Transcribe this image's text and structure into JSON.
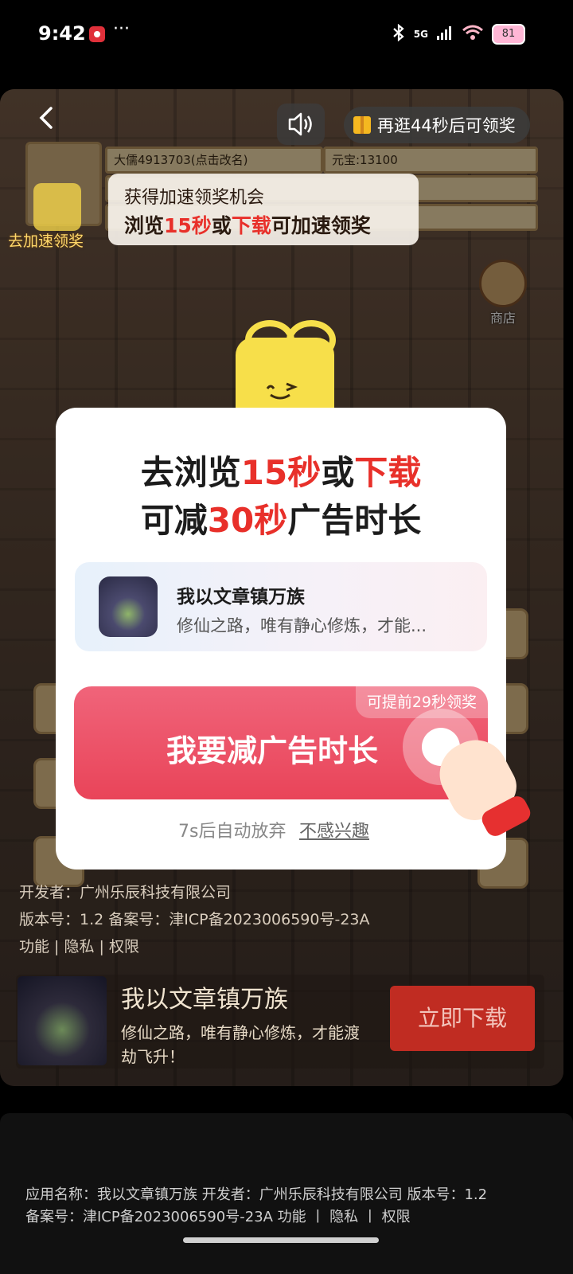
{
  "status_bar": {
    "time": "9:42",
    "dots": "···",
    "network": "5G",
    "battery": "81"
  },
  "game": {
    "player_name": "大儒4913703(点击改名)",
    "currency": "元宝:13100",
    "tip_line1": "获得加速领奖机会",
    "tip_line2_a": "浏览",
    "tip_line2_b": "15秒",
    "tip_line2_c": "或",
    "tip_line2_d": "下载",
    "tip_line2_e": "可加速领奖",
    "speed_label": "去加速领奖",
    "shop_label": "商店"
  },
  "reward_timer": "再逛44秒后可领奖",
  "dialog": {
    "title1_a": "去浏览",
    "title1_b": "15秒",
    "title1_c": "或",
    "title1_d": "下载",
    "title2_a": "可减",
    "title2_b": "30秒",
    "title2_c": "广告时长",
    "app_name": "我以文章镇万族",
    "app_desc": "修仙之路，唯有静心修炼，才能...",
    "cta_label": "我要减广告时长",
    "cta_badge": "可提前29秒领奖",
    "auto_abandon": "7s后自动放弃",
    "not_interested": "不感兴趣"
  },
  "dev_info": {
    "line1": "开发者：广州乐辰科技有限公司",
    "line2": "版本号：1.2   备案号：津ICP备2023006590号-23A",
    "line3": "功能 | 隐私 | 权限"
  },
  "ad_strip": {
    "title": "我以文章镇万族",
    "desc": "修仙之路，唯有静心修炼，才能渡劫飞升！",
    "download": "立即下载"
  },
  "footer": {
    "line1": "应用名称：我以文章镇万族    开发者：广州乐辰科技有限公司    版本号：1.2",
    "line2": "备案号：津ICP备2023006590号-23A    功能 丨 隐私 丨 权限"
  },
  "colors": {
    "accent_red": "#e8302a",
    "cta_pink": "#e94459",
    "mascot_yellow": "#f7df4a"
  }
}
